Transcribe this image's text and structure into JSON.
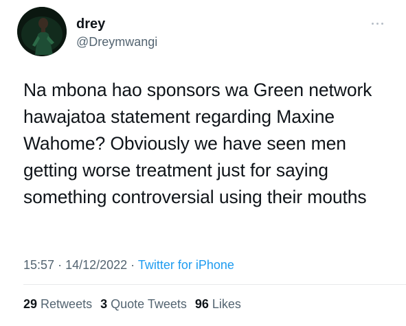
{
  "author": {
    "display_name": "drey",
    "handle": "@Dreymwangi"
  },
  "tweet": {
    "text": "Na mbona hao sponsors wa Green network hawajatoa statement regarding Maxine Wahome? Obviously we have seen men getting worse treatment just for saying something controversial using their mouths"
  },
  "meta": {
    "time": "15:57",
    "separator": "·",
    "date": "14/12/2022",
    "source": "Twitter for iPhone"
  },
  "stats": {
    "retweets_count": "29",
    "retweets_label": "Retweets",
    "quotes_count": "3",
    "quotes_label": "Quote Tweets",
    "likes_count": "96",
    "likes_label": "Likes"
  },
  "colors": {
    "text_primary": "#0f1419",
    "text_secondary": "#536471",
    "link": "#1d9bf0",
    "divider": "#e7e9ea"
  },
  "icons": {
    "more": "more-dots-icon",
    "avatar": "avatar"
  }
}
